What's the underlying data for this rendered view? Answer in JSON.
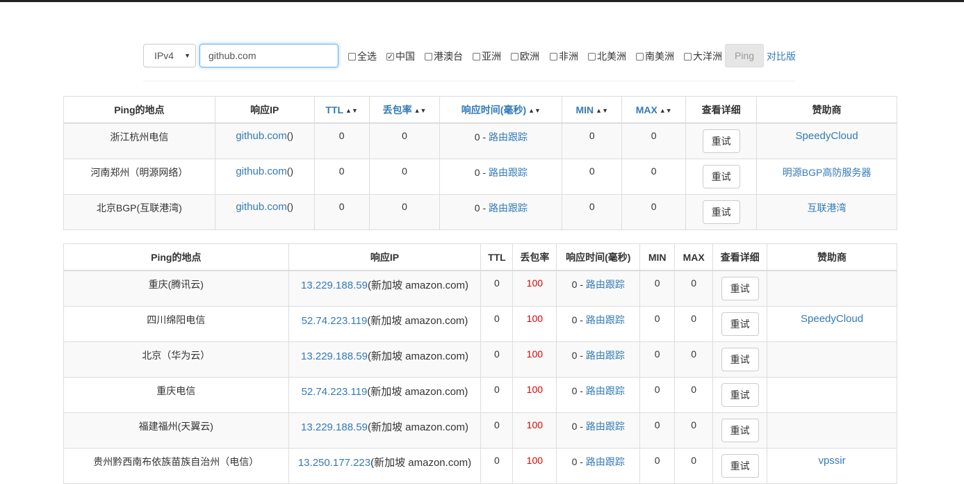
{
  "form": {
    "ip_version": "IPv4",
    "host_value": "github.com",
    "checkboxes": [
      {
        "label": "全选",
        "checked": false
      },
      {
        "label": "中国",
        "checked": true
      },
      {
        "label": "港澳台",
        "checked": false
      },
      {
        "label": "亚洲",
        "checked": false
      },
      {
        "label": "欧洲",
        "checked": false
      },
      {
        "label": "非洲",
        "checked": false
      },
      {
        "label": "北美洲",
        "checked": false
      },
      {
        "label": "南美洲",
        "checked": false
      },
      {
        "label": "大洋洲",
        "checked": false
      }
    ],
    "ping_label": "Ping",
    "compare_label": "对比版"
  },
  "table1": {
    "headers": {
      "location": "Ping的地点",
      "ip": "响应IP",
      "ttl": "TTL",
      "loss": "丢包率",
      "time": "响应时间(毫秒)",
      "min": "MIN",
      "max": "MAX",
      "detail": "查看详细",
      "sponsor": "赞助商"
    },
    "rows": [
      {
        "location": "浙江杭州电信",
        "ip": "github.com",
        "ip_suffix": "()",
        "ttl": "0",
        "loss": "0",
        "time": "0 - ",
        "route": "路由跟踪",
        "min": "0",
        "max": "0",
        "retry": "重试",
        "sponsor": "SpeedyCloud"
      },
      {
        "location": "河南郑州（明源网络）",
        "ip": "github.com",
        "ip_suffix": "()",
        "ttl": "0",
        "loss": "0",
        "time": "0 - ",
        "route": "路由跟踪",
        "min": "0",
        "max": "0",
        "retry": "重试",
        "sponsor": "明源BGP高防服务器"
      },
      {
        "location": "北京BGP(互联港湾)",
        "ip": "github.com",
        "ip_suffix": "()",
        "ttl": "0",
        "loss": "0",
        "time": "0 - ",
        "route": "路由跟踪",
        "min": "0",
        "max": "0",
        "retry": "重试",
        "sponsor": "互联港湾"
      }
    ]
  },
  "table2": {
    "headers": {
      "location": "Ping的地点",
      "ip": "响应IP",
      "ttl": "TTL",
      "loss": "丢包率",
      "time": "响应时间(毫秒)",
      "min": "MIN",
      "max": "MAX",
      "detail": "查看详细",
      "sponsor": "赞助商"
    },
    "rows": [
      {
        "location": "重庆(腾讯云)",
        "ip": "13.229.188.59",
        "ip_suffix": "(新加坡 amazon.com)",
        "ttl": "0",
        "loss": "100",
        "time": "0 - ",
        "route": "路由跟踪",
        "min": "0",
        "max": "0",
        "retry": "重试",
        "sponsor": ""
      },
      {
        "location": "四川绵阳电信",
        "ip": "52.74.223.119",
        "ip_suffix": "(新加坡 amazon.com)",
        "ttl": "0",
        "loss": "100",
        "time": "0 - ",
        "route": "路由跟踪",
        "min": "0",
        "max": "0",
        "retry": "重试",
        "sponsor": "SpeedyCloud"
      },
      {
        "location": "北京（华为云）",
        "ip": "13.229.188.59",
        "ip_suffix": "(新加坡 amazon.com)",
        "ttl": "0",
        "loss": "100",
        "time": "0 - ",
        "route": "路由跟踪",
        "min": "0",
        "max": "0",
        "retry": "重试",
        "sponsor": ""
      },
      {
        "location": "重庆电信",
        "ip": "52.74.223.119",
        "ip_suffix": "(新加坡 amazon.com)",
        "ttl": "0",
        "loss": "100",
        "time": "0 - ",
        "route": "路由跟踪",
        "min": "0",
        "max": "0",
        "retry": "重试",
        "sponsor": ""
      },
      {
        "location": "福建福州(天翼云)",
        "ip": "13.229.188.59",
        "ip_suffix": "(新加坡 amazon.com)",
        "ttl": "0",
        "loss": "100",
        "time": "0 - ",
        "route": "路由跟踪",
        "min": "0",
        "max": "0",
        "retry": "重试",
        "sponsor": ""
      },
      {
        "location": "贵州黔西南布依族苗族自治州（电信）",
        "ip": "13.250.177.223",
        "ip_suffix": "(新加坡 amazon.com)",
        "ttl": "0",
        "loss": "100",
        "time": "0 - ",
        "route": "路由跟踪",
        "min": "0",
        "max": "0",
        "retry": "重试",
        "sponsor": "vpssir"
      }
    ]
  },
  "colors": {
    "link": "#337ab7",
    "loss_high": "#e00000"
  },
  "icons": [
    "caret-down-icon",
    "sort-icon",
    "checkbox-icon"
  ]
}
